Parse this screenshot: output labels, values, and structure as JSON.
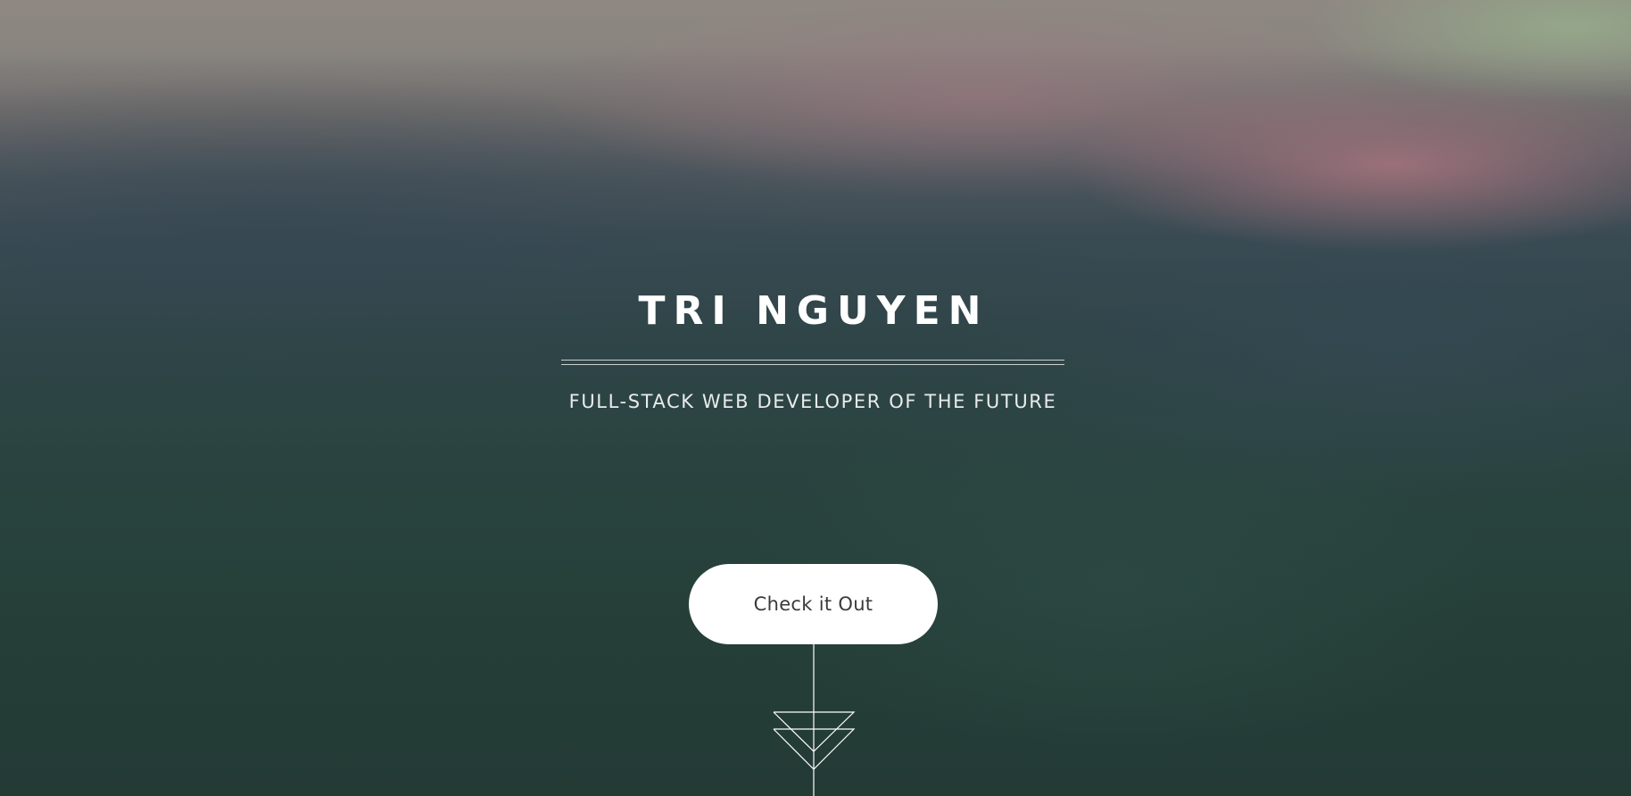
{
  "hero": {
    "title": "TRI NGUYEN",
    "subtitle": "FULL-STACK WEB DEVELOPER OF THE FUTURE",
    "cta_label": "Check it Out",
    "scroll_icon": "down-arrow-icon"
  },
  "colors": {
    "text": "#ffffff",
    "button_bg": "#ffffff",
    "button_text": "#3a3a3a",
    "background_dark": "#253d36"
  }
}
